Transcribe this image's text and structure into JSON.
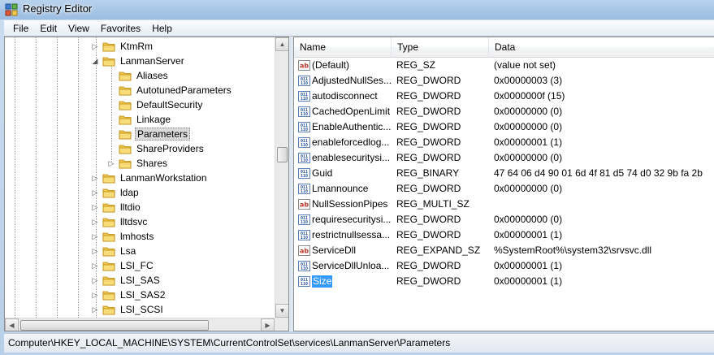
{
  "window": {
    "title": "Registry Editor"
  },
  "menu": [
    "File",
    "Edit",
    "View",
    "Favorites",
    "Help"
  ],
  "tree": [
    {
      "label": "KtmRm",
      "expander": "▷",
      "selected": false
    },
    {
      "label": "LanmanServer",
      "expander": "◢",
      "selected": false
    },
    {
      "label": "Aliases",
      "expander": "",
      "selected": false
    },
    {
      "label": "AutotunedParameters",
      "expander": "",
      "selected": false
    },
    {
      "label": "DefaultSecurity",
      "expander": "",
      "selected": false
    },
    {
      "label": "Linkage",
      "expander": "",
      "selected": false
    },
    {
      "label": "Parameters",
      "expander": "",
      "selected": true
    },
    {
      "label": "ShareProviders",
      "expander": "",
      "selected": false
    },
    {
      "label": "Shares",
      "expander": "▷",
      "selected": false
    },
    {
      "label": "LanmanWorkstation",
      "expander": "▷",
      "selected": false
    },
    {
      "label": "ldap",
      "expander": "▷",
      "selected": false
    },
    {
      "label": "lltdio",
      "expander": "▷",
      "selected": false
    },
    {
      "label": "lltdsvc",
      "expander": "▷",
      "selected": false
    },
    {
      "label": "lmhosts",
      "expander": "▷",
      "selected": false
    },
    {
      "label": "Lsa",
      "expander": "▷",
      "selected": false
    },
    {
      "label": "LSI_FC",
      "expander": "▷",
      "selected": false
    },
    {
      "label": "LSI_SAS",
      "expander": "▷",
      "selected": false
    },
    {
      "label": "LSI_SAS2",
      "expander": "▷",
      "selected": false
    },
    {
      "label": "LSI_SCSI",
      "expander": "▷",
      "selected": false
    }
  ],
  "columns": {
    "name": "Name",
    "type": "Type",
    "data": "Data"
  },
  "values": [
    {
      "icon": "string-value-icon",
      "name": "(Default)",
      "type": "REG_SZ",
      "data": "(value not set)",
      "selected": false
    },
    {
      "icon": "binary-value-icon",
      "name": "AdjustedNullSes...",
      "type": "REG_DWORD",
      "data": "0x00000003 (3)",
      "selected": false
    },
    {
      "icon": "binary-value-icon",
      "name": "autodisconnect",
      "type": "REG_DWORD",
      "data": "0x0000000f (15)",
      "selected": false
    },
    {
      "icon": "binary-value-icon",
      "name": "CachedOpenLimit",
      "type": "REG_DWORD",
      "data": "0x00000000 (0)",
      "selected": false
    },
    {
      "icon": "binary-value-icon",
      "name": "EnableAuthentic...",
      "type": "REG_DWORD",
      "data": "0x00000000 (0)",
      "selected": false
    },
    {
      "icon": "binary-value-icon",
      "name": "enableforcedlog...",
      "type": "REG_DWORD",
      "data": "0x00000001 (1)",
      "selected": false
    },
    {
      "icon": "binary-value-icon",
      "name": "enablesecuritysi...",
      "type": "REG_DWORD",
      "data": "0x00000000 (0)",
      "selected": false
    },
    {
      "icon": "binary-value-icon",
      "name": "Guid",
      "type": "REG_BINARY",
      "data": "47 64 06 d4 90 01 6d 4f 81 d5 74 d0 32 9b fa 2b",
      "selected": false
    },
    {
      "icon": "binary-value-icon",
      "name": "Lmannounce",
      "type": "REG_DWORD",
      "data": "0x00000000 (0)",
      "selected": false
    },
    {
      "icon": "string-value-icon",
      "name": "NullSessionPipes",
      "type": "REG_MULTI_SZ",
      "data": "",
      "selected": false
    },
    {
      "icon": "binary-value-icon",
      "name": "requiresecuritysi...",
      "type": "REG_DWORD",
      "data": "0x00000000 (0)",
      "selected": false
    },
    {
      "icon": "binary-value-icon",
      "name": "restrictnullsessa...",
      "type": "REG_DWORD",
      "data": "0x00000001 (1)",
      "selected": false
    },
    {
      "icon": "string-value-icon",
      "name": "ServiceDll",
      "type": "REG_EXPAND_SZ",
      "data": "%SystemRoot%\\system32\\srvsvc.dll",
      "selected": false
    },
    {
      "icon": "binary-value-icon",
      "name": "ServiceDllUnloa...",
      "type": "REG_DWORD",
      "data": "0x00000001 (1)",
      "selected": false
    },
    {
      "icon": "binary-value-icon",
      "name": "Size",
      "type": "REG_DWORD",
      "data": "0x00000001 (1)",
      "selected": true
    }
  ],
  "status": {
    "path": "Computer\\HKEY_LOCAL_MACHINE\\SYSTEM\\CurrentControlSet\\services\\LanmanServer\\Parameters"
  },
  "colors": {
    "selection": "#3399ff",
    "tree_selection": "#d9d9d9",
    "folder": "#f2c94c"
  }
}
